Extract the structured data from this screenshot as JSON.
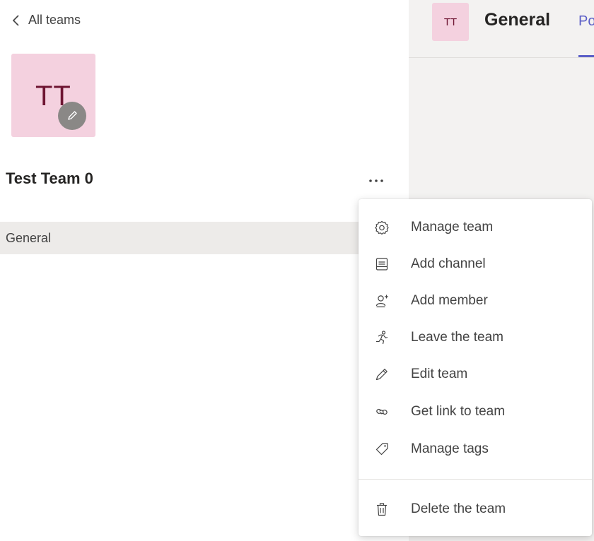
{
  "nav": {
    "back_label": "All teams"
  },
  "team": {
    "initials": "TT",
    "name": "Test Team 0"
  },
  "channels": [
    {
      "label": "General"
    }
  ],
  "header": {
    "avatar_initials": "TT",
    "title": "General",
    "tab_label": "Posts"
  },
  "colors": {
    "avatar_bg": "#f4d1df",
    "avatar_text": "#6e1532",
    "accent": "#5b5fc7",
    "selected_row": "#edebe9"
  },
  "menu": {
    "items": [
      {
        "label": "Manage team",
        "icon": "gear-icon"
      },
      {
        "label": "Add channel",
        "icon": "channel-list-icon"
      },
      {
        "label": "Add member",
        "icon": "person-add-icon"
      },
      {
        "label": "Leave the team",
        "icon": "running-person-icon"
      },
      {
        "label": "Edit team",
        "icon": "pencil-icon"
      },
      {
        "label": "Get link to team",
        "icon": "link-icon"
      },
      {
        "label": "Manage tags",
        "icon": "tag-icon"
      }
    ],
    "danger_item": {
      "label": "Delete the team",
      "icon": "trash-icon"
    }
  }
}
